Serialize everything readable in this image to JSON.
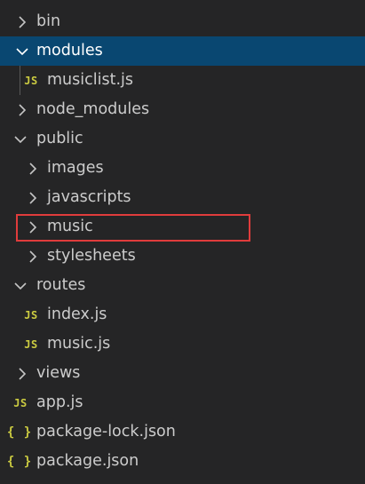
{
  "explorer": {
    "items": [
      {
        "label": "bin",
        "type": "folder",
        "state": "collapsed"
      },
      {
        "label": "modules",
        "type": "folder",
        "state": "expanded",
        "selected": true
      },
      {
        "label": "musiclist.js",
        "type": "file",
        "icon": "JS"
      },
      {
        "label": "node_modules",
        "type": "folder",
        "state": "collapsed"
      },
      {
        "label": "public",
        "type": "folder",
        "state": "expanded"
      },
      {
        "label": "images",
        "type": "folder",
        "state": "collapsed"
      },
      {
        "label": "javascripts",
        "type": "folder",
        "state": "collapsed"
      },
      {
        "label": "music",
        "type": "folder",
        "state": "collapsed",
        "highlighted": true
      },
      {
        "label": "stylesheets",
        "type": "folder",
        "state": "collapsed"
      },
      {
        "label": "routes",
        "type": "folder",
        "state": "expanded"
      },
      {
        "label": "index.js",
        "type": "file",
        "icon": "JS"
      },
      {
        "label": "music.js",
        "type": "file",
        "icon": "JS"
      },
      {
        "label": "views",
        "type": "folder",
        "state": "collapsed"
      },
      {
        "label": "app.js",
        "type": "file",
        "icon": "JS"
      },
      {
        "label": "package-lock.json",
        "type": "file",
        "icon": "{ }"
      },
      {
        "label": "package.json",
        "type": "file",
        "icon": "{ }"
      }
    ]
  },
  "colors": {
    "background": "#252526",
    "selected_row": "#094771",
    "text": "#cccccc",
    "js_icon": "#cbcb41",
    "json_icon": "#cbcb41",
    "highlight_border": "#e03c3c"
  }
}
